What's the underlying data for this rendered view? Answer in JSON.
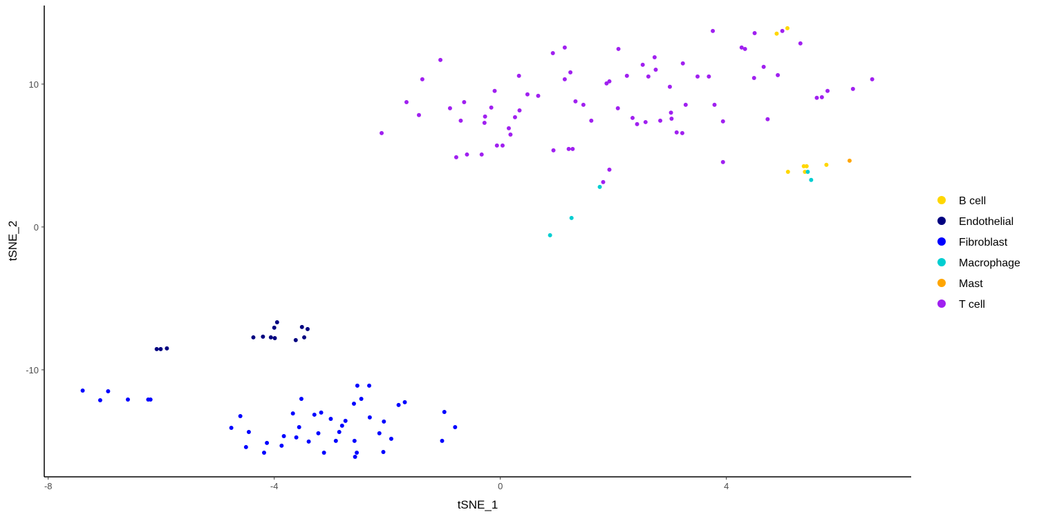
{
  "chart_data": {
    "type": "scatter",
    "title": "",
    "xlabel": "tSNE_1",
    "ylabel": "tSNE_2",
    "xlim": [
      -8.07,
      7.27
    ],
    "ylim": [
      -17.49,
      15.5
    ],
    "xticks": [
      -8,
      -4,
      0,
      4
    ],
    "yticks": [
      -10,
      0,
      10
    ],
    "grid": false,
    "legend_position": "right",
    "series": [
      {
        "name": "B cell",
        "color": "#FFD700",
        "points": [
          [
            4.89,
            13.53
          ],
          [
            5.08,
            13.91
          ],
          [
            5.09,
            3.86
          ],
          [
            5.37,
            4.25
          ],
          [
            5.42,
            4.25
          ],
          [
            5.39,
            3.86
          ],
          [
            5.77,
            4.35
          ]
        ]
      },
      {
        "name": "Endothelial",
        "color": "#000080",
        "points": [
          [
            -6.08,
            -8.55
          ],
          [
            -6.01,
            -8.55
          ],
          [
            -5.9,
            -8.5
          ],
          [
            -4.37,
            -7.73
          ],
          [
            -4.2,
            -7.68
          ],
          [
            -4.06,
            -7.73
          ],
          [
            -3.99,
            -7.78
          ],
          [
            -4.0,
            -7.05
          ],
          [
            -3.95,
            -6.67
          ],
          [
            -3.62,
            -7.92
          ],
          [
            -3.51,
            -7.0
          ],
          [
            -3.47,
            -7.73
          ],
          [
            -3.41,
            -7.15
          ]
        ]
      },
      {
        "name": "Fibroblast",
        "color": "#0000FF",
        "points": [
          [
            -7.39,
            -11.45
          ],
          [
            -7.08,
            -12.13
          ],
          [
            -6.94,
            -11.5
          ],
          [
            -6.59,
            -12.08
          ],
          [
            -6.23,
            -12.08
          ],
          [
            -6.19,
            -12.08
          ],
          [
            -4.76,
            -14.06
          ],
          [
            -4.6,
            -13.24
          ],
          [
            -4.45,
            -14.35
          ],
          [
            -4.5,
            -15.41
          ],
          [
            -4.18,
            -15.8
          ],
          [
            -4.13,
            -15.12
          ],
          [
            -3.87,
            -15.31
          ],
          [
            -3.83,
            -14.64
          ],
          [
            -3.67,
            -13.05
          ],
          [
            -3.61,
            -14.73
          ],
          [
            -3.56,
            -14.01
          ],
          [
            -3.52,
            -12.03
          ],
          [
            -3.39,
            -15.02
          ],
          [
            -3.29,
            -13.14
          ],
          [
            -3.17,
            -12.99
          ],
          [
            -3.22,
            -14.44
          ],
          [
            -3.12,
            -15.8
          ],
          [
            -3.0,
            -13.43
          ],
          [
            -2.91,
            -14.97
          ],
          [
            -2.85,
            -14.35
          ],
          [
            -2.8,
            -13.91
          ],
          [
            -2.74,
            -13.57
          ],
          [
            -2.59,
            -12.37
          ],
          [
            -2.58,
            -14.97
          ],
          [
            -2.57,
            -16.09
          ],
          [
            -2.54,
            -15.8
          ],
          [
            -2.53,
            -11.11
          ],
          [
            -2.46,
            -12.03
          ],
          [
            -2.32,
            -11.11
          ],
          [
            -2.31,
            -13.33
          ],
          [
            -2.14,
            -14.44
          ],
          [
            -2.06,
            -13.62
          ],
          [
            -2.07,
            -15.75
          ],
          [
            -1.93,
            -14.83
          ],
          [
            -1.8,
            -12.46
          ],
          [
            -1.69,
            -12.27
          ],
          [
            -1.03,
            -14.97
          ],
          [
            -0.99,
            -12.95
          ],
          [
            -0.8,
            -14.01
          ]
        ]
      },
      {
        "name": "Macrophage",
        "color": "#00CED1",
        "points": [
          [
            0.88,
            -0.58
          ],
          [
            1.26,
            0.63
          ],
          [
            1.76,
            2.8
          ],
          [
            5.44,
            3.86
          ],
          [
            5.5,
            3.29
          ]
        ]
      },
      {
        "name": "Mast",
        "color": "#FFA500",
        "points": [
          [
            6.18,
            4.64
          ]
        ]
      },
      {
        "name": "T cell",
        "color": "#A020F0",
        "points": [
          [
            -2.1,
            6.57
          ],
          [
            -1.66,
            8.74
          ],
          [
            -1.44,
            7.83
          ],
          [
            -1.38,
            10.34
          ],
          [
            -1.06,
            11.69
          ],
          [
            -0.89,
            8.31
          ],
          [
            -0.7,
            7.44
          ],
          [
            -0.64,
            8.74
          ],
          [
            -0.78,
            4.88
          ],
          [
            -0.59,
            5.07
          ],
          [
            -0.33,
            5.07
          ],
          [
            -0.28,
            7.29
          ],
          [
            -0.27,
            7.73
          ],
          [
            -0.16,
            8.36
          ],
          [
            -0.1,
            9.52
          ],
          [
            -0.06,
            5.7
          ],
          [
            0.04,
            5.7
          ],
          [
            0.15,
            6.91
          ],
          [
            0.18,
            6.47
          ],
          [
            0.26,
            7.68
          ],
          [
            0.34,
            8.16
          ],
          [
            0.33,
            10.58
          ],
          [
            0.48,
            9.28
          ],
          [
            0.67,
            9.18
          ],
          [
            0.93,
            12.17
          ],
          [
            0.94,
            5.36
          ],
          [
            1.14,
            12.56
          ],
          [
            1.14,
            10.34
          ],
          [
            1.24,
            10.82
          ],
          [
            1.21,
            5.46
          ],
          [
            1.28,
            5.46
          ],
          [
            1.33,
            8.79
          ],
          [
            1.47,
            8.55
          ],
          [
            1.61,
            7.44
          ],
          [
            1.82,
            3.14
          ],
          [
            1.88,
            10.05
          ],
          [
            1.93,
            10.19
          ],
          [
            1.93,
            4.01
          ],
          [
            2.09,
            12.46
          ],
          [
            2.08,
            8.31
          ],
          [
            2.24,
            10.58
          ],
          [
            2.34,
            7.63
          ],
          [
            2.42,
            7.2
          ],
          [
            2.52,
            11.35
          ],
          [
            2.57,
            7.34
          ],
          [
            2.62,
            10.53
          ],
          [
            2.73,
            11.88
          ],
          [
            2.75,
            11.01
          ],
          [
            2.83,
            7.44
          ],
          [
            3.0,
            9.81
          ],
          [
            3.02,
            8.0
          ],
          [
            3.03,
            7.58
          ],
          [
            3.12,
            6.62
          ],
          [
            3.22,
            6.57
          ],
          [
            3.23,
            11.45
          ],
          [
            3.28,
            8.55
          ],
          [
            3.49,
            10.53
          ],
          [
            3.69,
            10.53
          ],
          [
            3.76,
            13.72
          ],
          [
            3.79,
            8.55
          ],
          [
            3.94,
            7.39
          ],
          [
            3.94,
            4.54
          ],
          [
            4.27,
            12.56
          ],
          [
            4.33,
            12.46
          ],
          [
            4.5,
            13.57
          ],
          [
            4.49,
            10.43
          ],
          [
            4.66,
            11.21
          ],
          [
            4.73,
            7.54
          ],
          [
            4.91,
            10.63
          ],
          [
            4.99,
            13.72
          ],
          [
            5.31,
            12.85
          ],
          [
            5.6,
            9.04
          ],
          [
            5.69,
            9.08
          ],
          [
            5.79,
            9.52
          ],
          [
            6.24,
            9.66
          ],
          [
            6.58,
            10.34
          ]
        ]
      }
    ]
  }
}
